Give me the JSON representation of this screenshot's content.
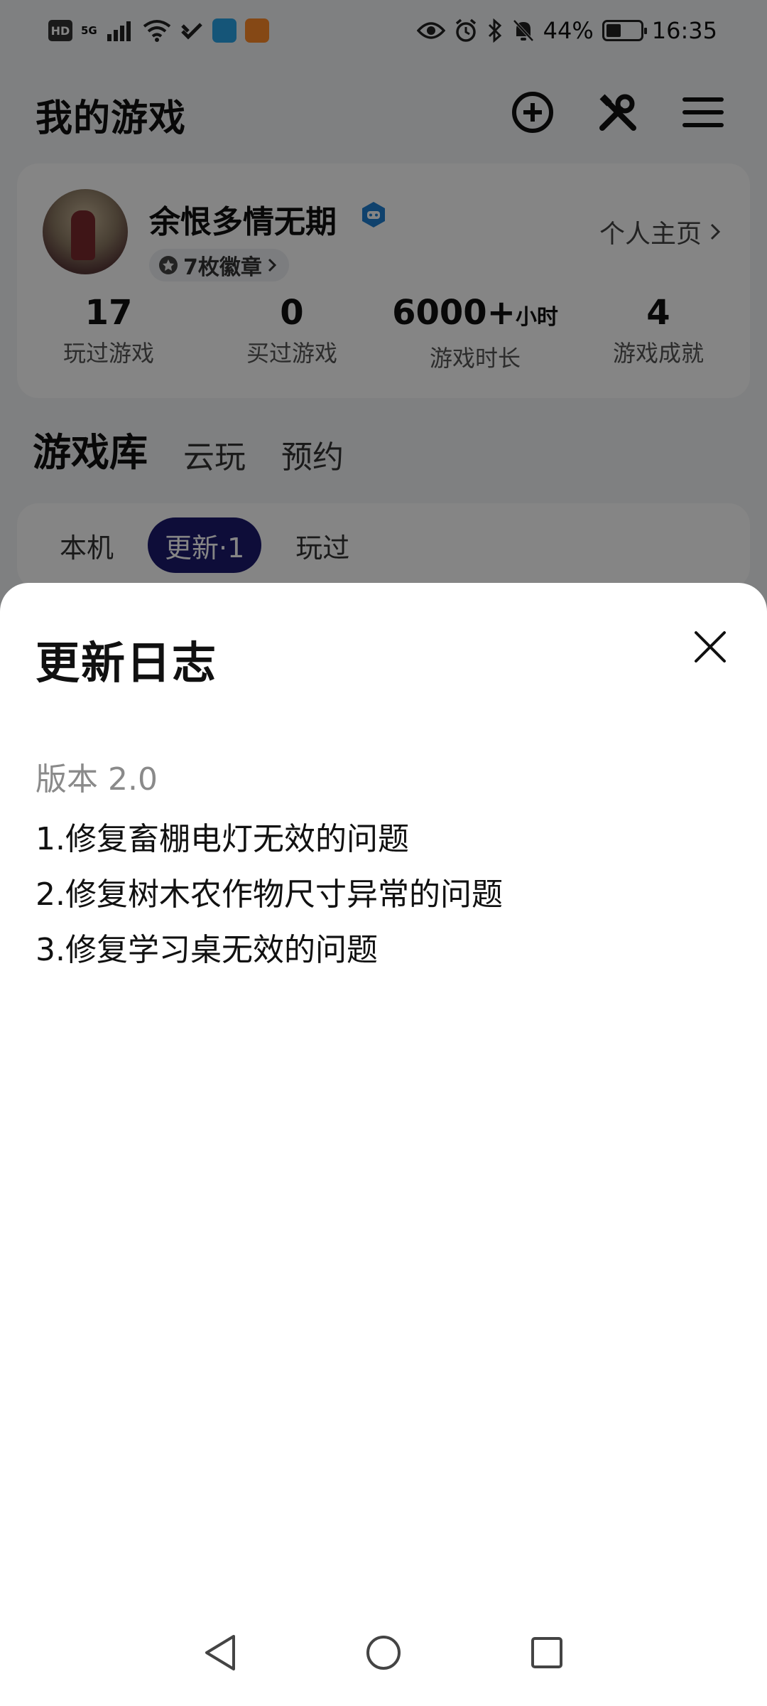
{
  "status_bar": {
    "hd": "HD",
    "network": "5G",
    "battery": "44%",
    "battery_level": 0.44,
    "time": "16:35"
  },
  "header": {
    "title": "我的游戏",
    "icons": [
      "add-circle-icon",
      "tools-icon",
      "menu-icon"
    ]
  },
  "profile": {
    "name": "余恨多情无期",
    "badges": "7枚徽章",
    "home_link": "个人主页",
    "stats": [
      {
        "value": "17",
        "unit": "",
        "label": "玩过游戏"
      },
      {
        "value": "0",
        "unit": "",
        "label": "买过游戏"
      },
      {
        "value": "6000+",
        "unit": "小时",
        "label": "游戏时长"
      },
      {
        "value": "4",
        "unit": "",
        "label": "游戏成就"
      }
    ]
  },
  "library": {
    "tabs": [
      "游戏库",
      "云玩",
      "预约"
    ],
    "chips": [
      "本机",
      "更新·1",
      "玩过"
    ]
  },
  "sheet": {
    "title": "更新日志",
    "version": "版本 2.0",
    "items": [
      "1.修复畜棚电灯无效的问题",
      "2.修复树木农作物尺寸异常的问题",
      "3.修复学习桌无效的问题"
    ]
  },
  "colors": {
    "accent_tab_underline": "#19c7a8",
    "active_chip": "#1b1a6e",
    "scrim": "rgba(0,0,0,0.48)"
  }
}
